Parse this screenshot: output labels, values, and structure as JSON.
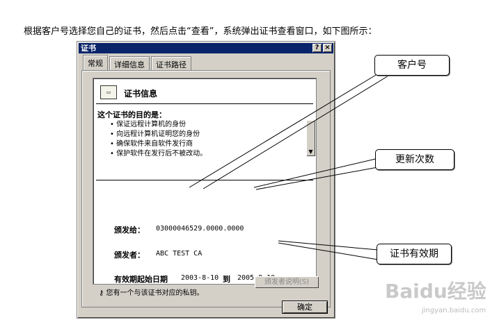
{
  "instruction": "根据客户号选择您自己的证书，然后点击“查看”，系统弹出证书查看窗口，如下图所示：",
  "dialog": {
    "title": "证书",
    "help_button": "?",
    "close_button": "×",
    "tabs": [
      {
        "label": "常规",
        "active": true
      },
      {
        "label": "详细信息",
        "active": false
      },
      {
        "label": "证书路径",
        "active": false
      }
    ],
    "cert_info": {
      "title": "证书信息",
      "purpose_title": "这个证书的目的是：",
      "purposes": [
        "保证远程计算机的身份",
        "向远程计算机证明您的身份",
        "确保软件来自软件发行商",
        "保护软件在发行后不被改动。"
      ],
      "issued_to_label": "颁发给：",
      "issued_to_value": "03000046529.0000.0000",
      "issued_by_label": "颁发者：",
      "issued_by_value": "ABC TEST CA",
      "valid_from_label": "有效期起始日期",
      "valid_from": "2003-8-10",
      "valid_to_label": "到",
      "valid_to": "2005-8-10",
      "key_note": "您有一个与该证书对应的私钥。"
    },
    "issuer_statement_button": "颁发者说明(S)",
    "ok_button": "确定"
  },
  "callouts": {
    "customer_no": "客户号",
    "renewal_count": "更新次数",
    "validity": "证书有效期"
  },
  "watermark": {
    "text": "Baidu经验",
    "sub": "jingyan.baidu.com"
  }
}
